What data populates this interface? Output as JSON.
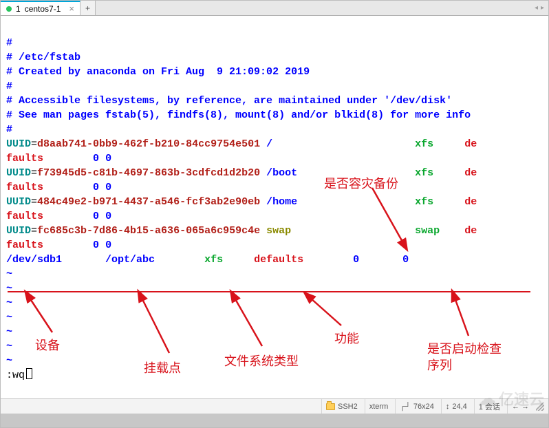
{
  "tab": {
    "index": "1",
    "title": "centos7-1",
    "close": "×",
    "new": "+",
    "left_arrow": "◂",
    "right_arrow": "▸"
  },
  "fstab": {
    "c1": "#",
    "c2": "# /etc/fstab",
    "c3": "# Created by anaconda on Fri Aug  9 21:09:02 2019",
    "c4": "#",
    "c5": "# Accessible filesystems, by reference, are maintained under '/dev/disk'",
    "c6": "# See man pages fstab(5), findfs(8), mount(8) and/or blkid(8) for more info",
    "c7": "#",
    "uuid_label": "UUID",
    "entries": [
      {
        "uuid": "d8aab741-0bb9-462f-b210-84cc9754e501",
        "mount": "/",
        "fs": "xfs",
        "opt1": "de",
        "opt2": "faults",
        "d1": "0",
        "d2": "0"
      },
      {
        "uuid": "f73945d5-c81b-4697-863b-3cdfcd1d2b20",
        "mount": "/boot",
        "fs": "xfs",
        "opt1": "de",
        "opt2": "faults",
        "d1": "0",
        "d2": "0"
      },
      {
        "uuid": "484c49e2-b971-4437-a546-fcf3ab2e90eb",
        "mount": "/home",
        "fs": "xfs",
        "opt1": "de",
        "opt2": "faults",
        "d1": "0",
        "d2": "0"
      },
      {
        "uuid": "fc685c3b-7d86-4b15-a636-065a6c959c4e",
        "mount": "swap",
        "fs": "swap",
        "opt1": "de",
        "opt2": "faults",
        "d1": "0",
        "d2": "0"
      }
    ],
    "manual": {
      "dev": "/dev/sdb1",
      "mount": "/opt/abc",
      "fs": "xfs",
      "opts": "defaults",
      "d1": "0",
      "d2": "0"
    },
    "command": ":wq"
  },
  "annotations": {
    "backup": "是否容灾备份",
    "device": "设备",
    "mountpoint": "挂载点",
    "fstype": "文件系统类型",
    "function": "功能",
    "bootcheck1": "是否启动检查",
    "bootcheck2": "序列"
  },
  "status": {
    "proto": "SSH2",
    "term": "xterm",
    "size_icon": "┌┘",
    "size": "76x24",
    "pos_icon": "↕",
    "pos": "24,4",
    "sessions": "1 会话",
    "arrows": "←  →"
  },
  "watermark": {
    "cloud": "☁",
    "text": "亿速云"
  }
}
